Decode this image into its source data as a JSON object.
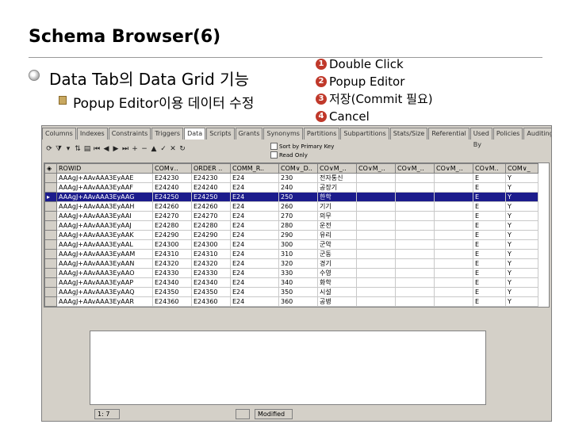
{
  "slide": {
    "title": "Schema Browser(6)",
    "bullet1": "Data Tab의 Data Grid 기능",
    "bullet2": "Popup Editor이용 데이터 수정",
    "steps": [
      {
        "num": "1",
        "label": "Double Click"
      },
      {
        "num": "2",
        "label": "Popup Editor"
      },
      {
        "num": "3",
        "label": "저장(Commit 필요)"
      },
      {
        "num": "4",
        "label": "Cancel"
      }
    ]
  },
  "app": {
    "tabs": [
      "Columns",
      "Indexes",
      "Constraints",
      "Triggers",
      "Data",
      "Scripts",
      "Grants",
      "Synonyms",
      "Partitions",
      "Subpartitions",
      "Stats/Size",
      "Referential",
      "Used By",
      "Policies",
      "Auditing"
    ],
    "active_tab": "Data",
    "sort_label": "Sort by Primary Key",
    "readonly_label": "Read Only",
    "columns": [
      "ROWID",
      "COM∨..",
      "ORDER ..",
      "COMM_R..",
      "COM∨_D..",
      "CO∨M_..",
      "CO∨M_..",
      "CO∨M_..",
      "CO∨M_..",
      "CO∨M..",
      "COM∨_"
    ],
    "rows": [
      [
        "AAAgJ+AAvAAA3EyAAE",
        "E24230",
        "E24230",
        "E24",
        "230",
        "전자통신",
        "",
        "",
        "",
        "E",
        "Y"
      ],
      [
        "AAAgJ+AAvAAA3EyAAF",
        "E24240",
        "E24240",
        "E24",
        "240",
        "공장기",
        "",
        "",
        "",
        "E",
        "Y"
      ],
      [
        "AAAgJ+AAvAAA3EyAAG",
        "E24250",
        "E24250",
        "E24",
        "250",
        "한학",
        "",
        "",
        "",
        "E",
        "Y"
      ],
      [
        "AAAgJ+AAvAAA3EyAAH",
        "E24260",
        "E24260",
        "E24",
        "260",
        "기기",
        "",
        "",
        "",
        "E",
        "Y"
      ],
      [
        "AAAgJ+AAvAAA3EyAAI",
        "E24270",
        "E24270",
        "E24",
        "270",
        "의무",
        "",
        "",
        "",
        "E",
        "Y"
      ],
      [
        "AAAgJ+AAvAAA3EyAAJ",
        "E24280",
        "E24280",
        "E24",
        "280",
        "운전",
        "",
        "",
        "",
        "E",
        "Y"
      ],
      [
        "AAAgJ+AAvAAA3EyAAK",
        "E24290",
        "E24290",
        "E24",
        "290",
        "유리",
        "",
        "",
        "",
        "E",
        "Y"
      ],
      [
        "AAAgJ+AAvAAA3EyAAL",
        "E24300",
        "E24300",
        "E24",
        "300",
        "군악",
        "",
        "",
        "",
        "E",
        "Y"
      ],
      [
        "AAAgJ+AAvAAA3EyAAM",
        "E24310",
        "E24310",
        "E24",
        "310",
        "군동",
        "",
        "",
        "",
        "E",
        "Y"
      ],
      [
        "AAAgJ+AAvAAA3EyAAN",
        "E24320",
        "E24320",
        "E24",
        "320",
        "경기",
        "",
        "",
        "",
        "E",
        "Y"
      ],
      [
        "AAAgJ+AAvAAA3EyAAO",
        "E24330",
        "E24330",
        "E24",
        "330",
        "수영",
        "",
        "",
        "",
        "E",
        "Y"
      ],
      [
        "AAAgJ+AAvAAA3EyAAP",
        "E24340",
        "E24340",
        "E24",
        "340",
        "화학",
        "",
        "",
        "",
        "E",
        "Y"
      ],
      [
        "AAAgJ+AAvAAA3EyAAQ",
        "E24350",
        "E24350",
        "E24",
        "350",
        "시설",
        "",
        "",
        "",
        "E",
        "Y"
      ],
      [
        "AAAgJ+AAvAAA3EyAAR",
        "E24360",
        "E24360",
        "E24",
        "360",
        "공병",
        "",
        "",
        "",
        "E",
        "Y"
      ]
    ],
    "selected_row": 2,
    "status_pos": "1:  7",
    "status_state": "Modified"
  }
}
